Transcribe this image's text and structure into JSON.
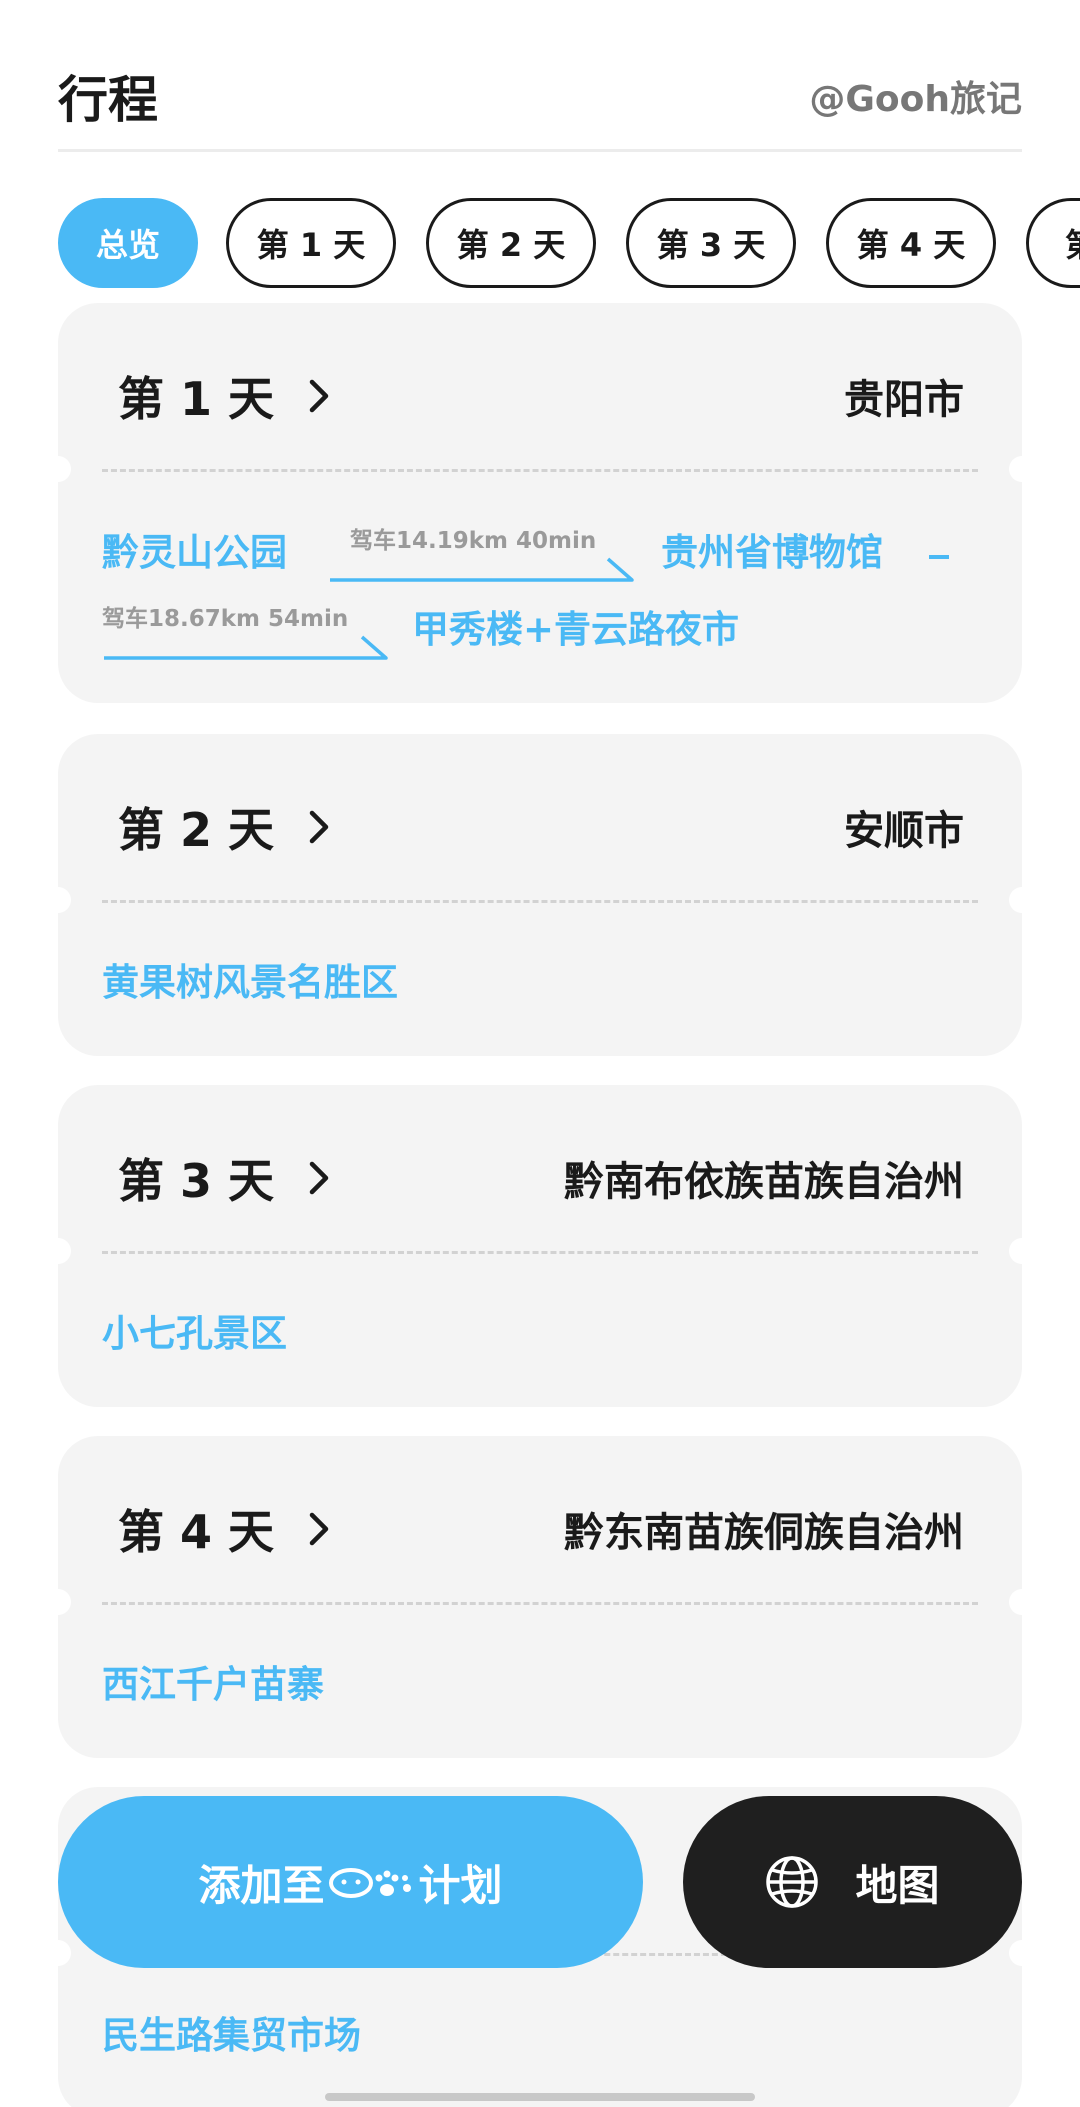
{
  "header": {
    "title": "行程",
    "brand": "@Gooh旅记"
  },
  "tabs": [
    {
      "label": "总览",
      "active": true
    },
    {
      "label": "第 1 天",
      "active": false
    },
    {
      "label": "第 2 天",
      "active": false
    },
    {
      "label": "第 3 天",
      "active": false
    },
    {
      "label": "第 4 天",
      "active": false
    },
    {
      "label": "第",
      "active": false
    }
  ],
  "days": [
    {
      "title": "第 1 天",
      "city": "贵阳市",
      "stops": [
        "黔灵山公园",
        "贵州省博物馆",
        "甲秀楼+青云路夜市"
      ],
      "routes": [
        "驾车14.19km 40min",
        "驾车18.67km 54min"
      ]
    },
    {
      "title": "第 2 天",
      "city": "安顺市",
      "stops": [
        "黄果树风景名胜区"
      ]
    },
    {
      "title": "第 3 天",
      "city": "黔南布依族苗族自治州",
      "stops": [
        "小七孔景区"
      ]
    },
    {
      "title": "第 4 天",
      "city": "黔东南苗族侗族自治州",
      "stops": [
        "西江千户苗寨"
      ]
    },
    {
      "stops": [
        "民生路集贸市场"
      ]
    }
  ],
  "actions": {
    "add_plan_prefix": "添加至",
    "add_plan_suffix": "计划",
    "map_label": "地图"
  },
  "colors": {
    "accent": "#4ab9f5",
    "dark": "#1f1f1f",
    "card": "#f4f4f4"
  },
  "icons": {
    "chevron": "chevron-right-icon",
    "globe": "globe-icon",
    "mascot": "mascot-icon"
  }
}
